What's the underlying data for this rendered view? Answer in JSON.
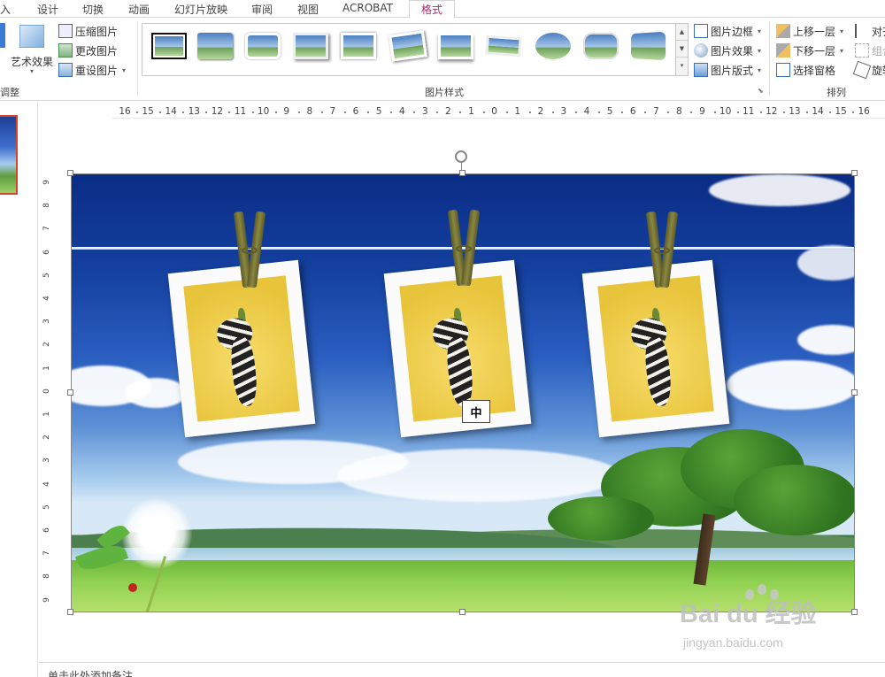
{
  "tabs": [
    {
      "label": "入"
    },
    {
      "label": "设计"
    },
    {
      "label": "切换"
    },
    {
      "label": "动画"
    },
    {
      "label": "幻灯片放映"
    },
    {
      "label": "审阅"
    },
    {
      "label": "视图"
    },
    {
      "label": "ACROBAT"
    },
    {
      "label": "格式"
    }
  ],
  "adjust_group": {
    "art_effects": "艺术效果",
    "compress": "压缩图片",
    "change": "更改图片",
    "reset": "重设图片",
    "label": "调整"
  },
  "styles_group": {
    "label": "图片样式",
    "border": "图片边框",
    "effects": "图片效果",
    "layout": "图片版式"
  },
  "arrange_group": {
    "label": "排列",
    "bring_forward": "上移一层",
    "send_backward": "下移一层",
    "selection_pane": "选择窗格",
    "align": "对齐",
    "group": "组合",
    "rotate": "旋转"
  },
  "ruler_h": [
    "16",
    "15",
    "14",
    "13",
    "12",
    "11",
    "10",
    "9",
    "8",
    "7",
    "6",
    "5",
    "4",
    "3",
    "2",
    "1",
    "0",
    "1",
    "2",
    "3",
    "4",
    "5",
    "6",
    "7",
    "8",
    "9",
    "10",
    "11",
    "12",
    "13",
    "14",
    "15",
    "16"
  ],
  "ruler_v": [
    "9",
    "8",
    "7",
    "6",
    "5",
    "4",
    "3",
    "2",
    "1",
    "0",
    "1",
    "2",
    "3",
    "4",
    "5",
    "6",
    "7",
    "8",
    "9"
  ],
  "ime_indicator": "中",
  "notes_text": "单击此处添加备注",
  "watermark": {
    "brand": "Bai du 经验",
    "site": "jingyan.baidu.com"
  },
  "colors": {
    "active_tab": "#a5306c",
    "selection_border": "#d24726"
  }
}
